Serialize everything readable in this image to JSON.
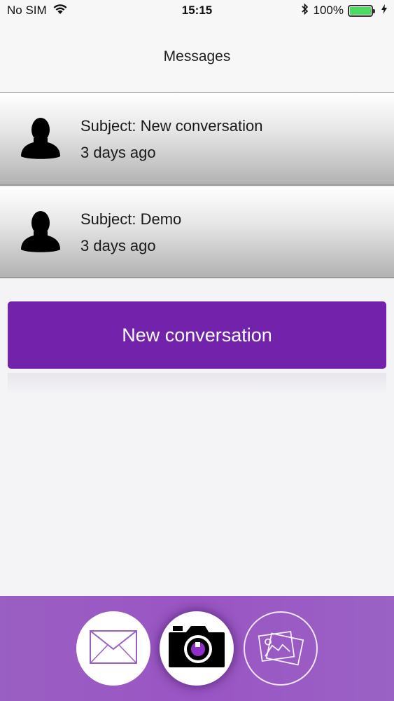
{
  "status_bar": {
    "carrier": "No SIM",
    "time": "15:15",
    "battery_percent": "100%",
    "battery_color": "#4cd964"
  },
  "header": {
    "title": "Messages"
  },
  "conversations": [
    {
      "subject": "Subject: New conversation",
      "time": "3 days ago",
      "icon": "person-silhouette-icon"
    },
    {
      "subject": "Subject: Demo",
      "time": "3 days ago",
      "icon": "person-silhouette-icon"
    }
  ],
  "new_conversation": {
    "label": "New conversation",
    "color": "#7322ab"
  },
  "tab_bar": {
    "background": "#9a5fc2",
    "items": [
      {
        "icon": "mail-icon"
      },
      {
        "icon": "camera-icon",
        "selected": true
      },
      {
        "icon": "gallery-icon"
      }
    ]
  }
}
